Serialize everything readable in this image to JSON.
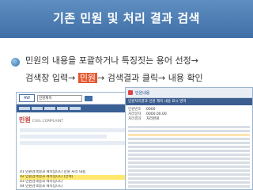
{
  "slide": {
    "title": "기존 민원 및 처리 결과 검색",
    "bullet_line1": "민원의 내용을 포괄하거나 특징짓는 용어 선정→",
    "bullet_line2_a": "검색창 입력→ ",
    "bullet_line2_highlight": "민원",
    "bullet_line2_b": "→ 검색결과 클릭→ 내용 확인"
  },
  "shot1": {
    "logo": "AW",
    "search_value": "민원제목",
    "section_title_ko": "민원",
    "section_title_en": "CIVIL COMPLAINT",
    "results": [
      "01 민원검색결과 제목입니다 민원 처리 내용",
      "02 민원검색결과 제목입니다 (선택)",
      "03 민원검색결과 제목입니다",
      "04 민원검색결과 제목입니다"
    ]
  },
  "shot2": {
    "header_label": "민원내용",
    "title_text": "민원처리결과 민원 제목 내용 표시 영역",
    "fields": [
      {
        "k": "민원번호",
        "v": "0000"
      },
      {
        "k": "처리일자",
        "v": "0000.00.00"
      },
      {
        "k": "처리결과",
        "v": "처리완료"
      }
    ]
  },
  "colors": {
    "title_bg": "#4a7bb3",
    "highlight": "#e4572e",
    "selected_row": "#ffe86b"
  }
}
